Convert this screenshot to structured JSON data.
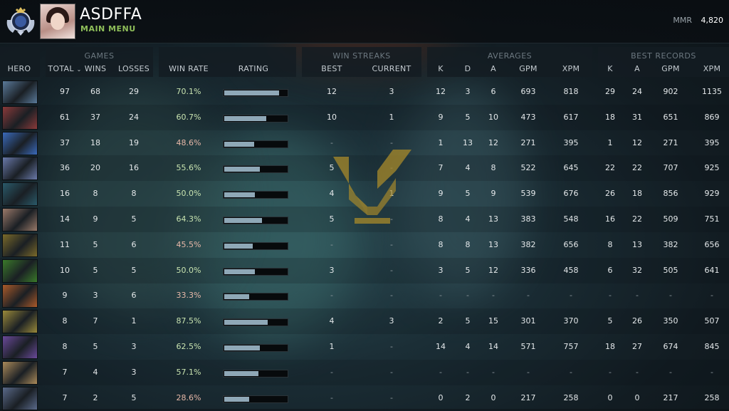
{
  "header": {
    "player_name": "ASDFFA",
    "subtitle": "MAIN MENU",
    "mmr_label": "MMR",
    "mmr_value": "4,820"
  },
  "groups": {
    "games": "GAMES",
    "win_streaks": "WIN STREAKS",
    "averages": "AVERAGES",
    "best_records": "BEST RECORDS"
  },
  "columns": {
    "hero": "HERO",
    "total": "TOTAL",
    "wins": "WINS",
    "losses": "LOSSES",
    "win_rate": "WIN RATE",
    "rating": "RATING",
    "best": "BEST",
    "current": "CURRENT",
    "avg_k": "K",
    "avg_d": "D",
    "avg_a": "A",
    "avg_gpm": "GPM",
    "avg_xpm": "XPM",
    "rec_k": "K",
    "rec_a": "A",
    "rec_gpm": "GPM",
    "rec_xpm": "XPM"
  },
  "rows": [
    {
      "hero": "hero-1",
      "color": "#5a7a9a",
      "total": "97",
      "wins": "68",
      "losses": "29",
      "win_rate": "70.1%",
      "rating": 0.88,
      "best": "12",
      "current": "3",
      "k": "12",
      "d": "3",
      "a": "6",
      "gpm": "693",
      "xpm": "818",
      "rk": "29",
      "ra": "24",
      "rgpm": "902",
      "rxpm": "1135"
    },
    {
      "hero": "hero-2",
      "color": "#8a3a3a",
      "total": "61",
      "wins": "37",
      "losses": "24",
      "win_rate": "60.7%",
      "rating": 0.67,
      "best": "10",
      "current": "1",
      "k": "9",
      "d": "5",
      "a": "10",
      "gpm": "473",
      "xpm": "617",
      "rk": "18",
      "ra": "31",
      "rgpm": "651",
      "rxpm": "869"
    },
    {
      "hero": "hero-3",
      "color": "#3a6aba",
      "total": "37",
      "wins": "18",
      "losses": "19",
      "win_rate": "48.6%",
      "rating": 0.48,
      "best": "-",
      "current": "-",
      "k": "1",
      "d": "13",
      "a": "12",
      "gpm": "271",
      "xpm": "395",
      "rk": "1",
      "ra": "12",
      "rgpm": "271",
      "rxpm": "395"
    },
    {
      "hero": "hero-4",
      "color": "#6a7aaa",
      "total": "36",
      "wins": "20",
      "losses": "16",
      "win_rate": "55.6%",
      "rating": 0.57,
      "best": "5",
      "current": "-",
      "k": "7",
      "d": "4",
      "a": "8",
      "gpm": "522",
      "xpm": "645",
      "rk": "22",
      "ra": "22",
      "rgpm": "707",
      "rxpm": "925"
    },
    {
      "hero": "hero-5",
      "color": "#2a5a6a",
      "total": "16",
      "wins": "8",
      "losses": "8",
      "win_rate": "50.0%",
      "rating": 0.49,
      "best": "4",
      "current": "1",
      "k": "9",
      "d": "5",
      "a": "9",
      "gpm": "539",
      "xpm": "676",
      "rk": "26",
      "ra": "18",
      "rgpm": "856",
      "rxpm": "929"
    },
    {
      "hero": "hero-6",
      "color": "#9a7a6a",
      "total": "14",
      "wins": "9",
      "losses": "5",
      "win_rate": "64.3%",
      "rating": 0.6,
      "best": "5",
      "current": "-",
      "k": "8",
      "d": "4",
      "a": "13",
      "gpm": "383",
      "xpm": "548",
      "rk": "16",
      "ra": "22",
      "rgpm": "509",
      "rxpm": "751"
    },
    {
      "hero": "hero-7",
      "color": "#7a6a2a",
      "total": "11",
      "wins": "5",
      "losses": "6",
      "win_rate": "45.5%",
      "rating": 0.46,
      "best": "-",
      "current": "-",
      "k": "8",
      "d": "8",
      "a": "13",
      "gpm": "382",
      "xpm": "656",
      "rk": "8",
      "ra": "13",
      "rgpm": "382",
      "rxpm": "656"
    },
    {
      "hero": "hero-8",
      "color": "#3a7a2a",
      "total": "10",
      "wins": "5",
      "losses": "5",
      "win_rate": "50.0%",
      "rating": 0.49,
      "best": "3",
      "current": "-",
      "k": "3",
      "d": "5",
      "a": "12",
      "gpm": "336",
      "xpm": "458",
      "rk": "6",
      "ra": "32",
      "rgpm": "505",
      "rxpm": "641"
    },
    {
      "hero": "hero-9",
      "color": "#aa5a2a",
      "total": "9",
      "wins": "3",
      "losses": "6",
      "win_rate": "33.3%",
      "rating": 0.4,
      "best": "-",
      "current": "-",
      "k": "-",
      "d": "-",
      "a": "-",
      "gpm": "-",
      "xpm": "-",
      "rk": "-",
      "ra": "-",
      "rgpm": "-",
      "rxpm": "-"
    },
    {
      "hero": "hero-10",
      "color": "#9a8a3a",
      "total": "8",
      "wins": "7",
      "losses": "1",
      "win_rate": "87.5%",
      "rating": 0.69,
      "best": "4",
      "current": "3",
      "k": "2",
      "d": "5",
      "a": "15",
      "gpm": "301",
      "xpm": "370",
      "rk": "5",
      "ra": "26",
      "rgpm": "350",
      "rxpm": "507"
    },
    {
      "hero": "hero-11",
      "color": "#6a4a9a",
      "total": "8",
      "wins": "5",
      "losses": "3",
      "win_rate": "62.5%",
      "rating": 0.57,
      "best": "1",
      "current": "-",
      "k": "14",
      "d": "4",
      "a": "14",
      "gpm": "571",
      "xpm": "757",
      "rk": "18",
      "ra": "27",
      "rgpm": "674",
      "rxpm": "845"
    },
    {
      "hero": "hero-12",
      "color": "#aa8a5a",
      "total": "7",
      "wins": "4",
      "losses": "3",
      "win_rate": "57.1%",
      "rating": 0.54,
      "best": "-",
      "current": "-",
      "k": "-",
      "d": "-",
      "a": "-",
      "gpm": "-",
      "xpm": "-",
      "rk": "-",
      "ra": "-",
      "rgpm": "-",
      "rxpm": "-"
    },
    {
      "hero": "hero-13",
      "color": "#5a6a8a",
      "total": "7",
      "wins": "2",
      "losses": "5",
      "win_rate": "28.6%",
      "rating": 0.4,
      "best": "-",
      "current": "-",
      "k": "0",
      "d": "2",
      "a": "0",
      "gpm": "217",
      "xpm": "258",
      "rk": "0",
      "ra": "0",
      "rgpm": "217",
      "rxpm": "258"
    }
  ]
}
